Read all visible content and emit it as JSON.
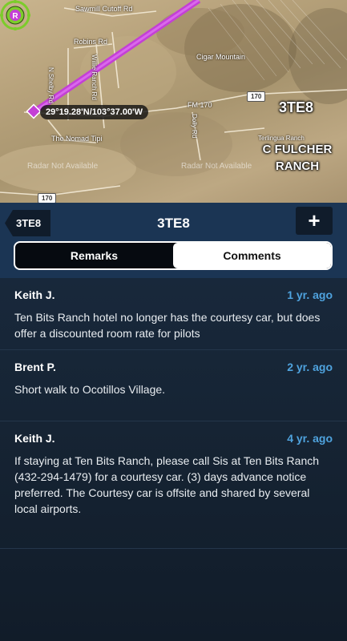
{
  "map": {
    "roads": [
      "Sawmill Cutoff Rd",
      "Robins Rd",
      "N Shelby Rd",
      "Willie Ranch Rd",
      "FM 170",
      "Dolly Rd"
    ],
    "places": [
      "Cigar Mountain",
      "The Nomad Tipi",
      "Terlingua Ranch"
    ],
    "radar_notice": "Radar Not Available",
    "highway_shield": "170",
    "coordinate": "29°19.28'N/103°37.00'W",
    "airport_id": "3TE8",
    "airport_name": "C FULCHER RANCH",
    "airport_marker_letter": "R",
    "route_color": "#c43fd6"
  },
  "header": {
    "back_label": "3TE8",
    "title": "3TE8",
    "add_label": "+"
  },
  "segments": [
    {
      "label": "Remarks",
      "selected": false
    },
    {
      "label": "Comments",
      "selected": true
    }
  ],
  "comments": [
    {
      "author": "Keith J.",
      "age": "1 yr. ago",
      "text": "Ten Bits Ranch hotel no longer has the courtesy car, but does offer a discounted room rate for pilots"
    },
    {
      "author": "Brent P.",
      "age": "2 yr. ago",
      "text": "Short walk to Ocotillos Village."
    },
    {
      "author": "Keith J.",
      "age": "4 yr. ago",
      "text": "If staying at Ten Bits Ranch, please call Sis at Ten Bits Ranch (432-294-1479) for a courtesy car.  (3) days advance notice preferred.  The Courtesy car is offsite and shared by several local airports."
    }
  ],
  "colors": {
    "header_bg": "#1b3554",
    "list_bg": "#162434",
    "age_blue": "#4fa3de",
    "airport_green": "#7ccc2b"
  }
}
